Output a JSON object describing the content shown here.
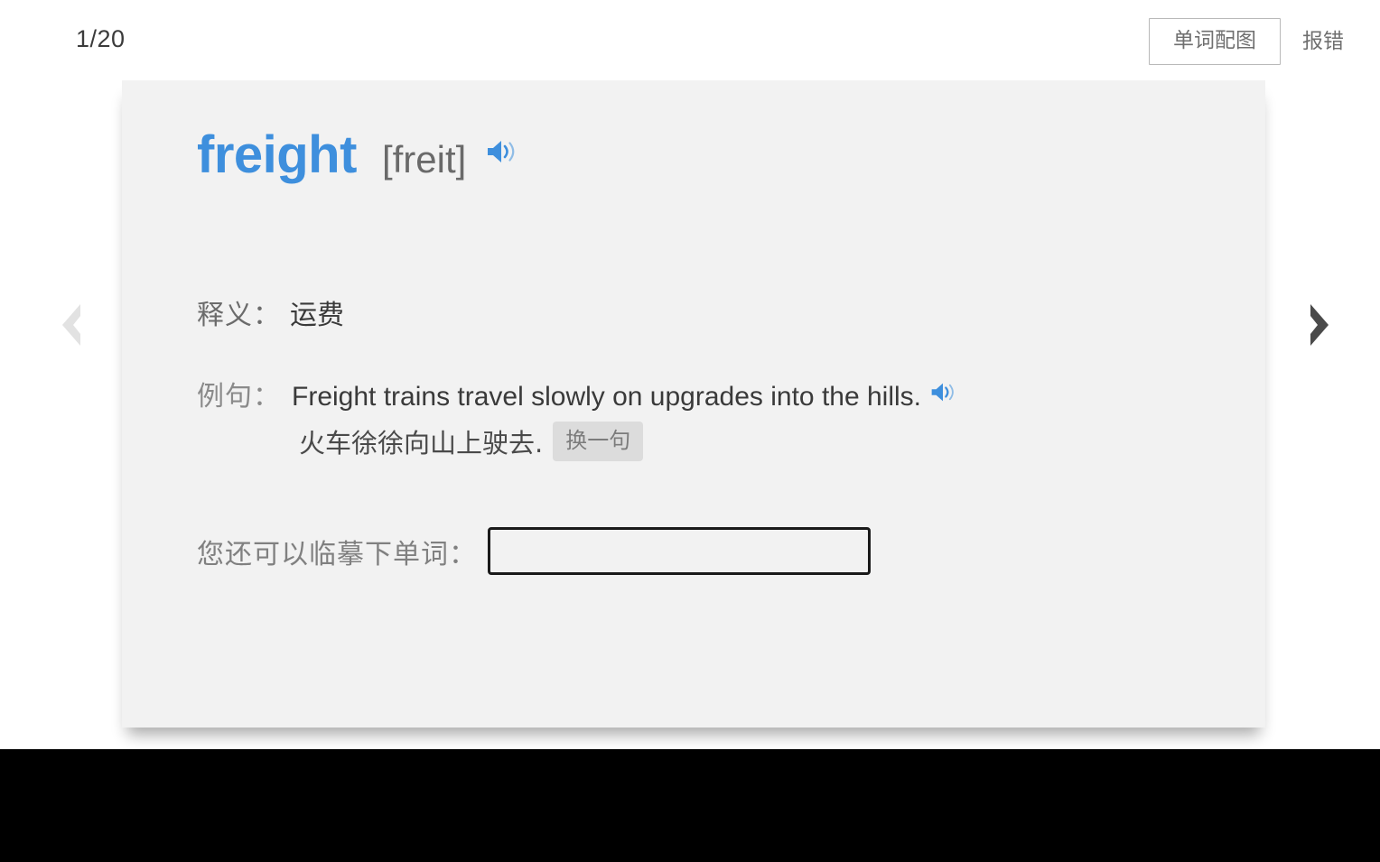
{
  "header": {
    "progress": "1/20",
    "illustration_button": "单词配图",
    "report_link": "报错"
  },
  "card": {
    "word": "freight",
    "phonetic": "[freit]",
    "word_audio_icon": "speaker-icon",
    "definition": {
      "label": "释义：",
      "value": "运费"
    },
    "example": {
      "label": "例句：",
      "english": "Freight trains travel slowly on upgrades into the hills.",
      "audio_icon": "speaker-icon",
      "chinese": "火车徐徐向山上驶去.",
      "change_button": "换一句"
    },
    "practice": {
      "label": "您还可以临摹下单词：",
      "value": "",
      "placeholder": ""
    }
  },
  "navigation": {
    "prev_icon": "chevron-left-icon",
    "next_icon": "chevron-right-icon",
    "prev_enabled": false,
    "next_enabled": true
  },
  "colors": {
    "word_blue": "#3e8fdd",
    "card_bg": "#f2f2f2",
    "page_bg": "#ffffff",
    "band_black": "#000000",
    "arrow_active": "#4a4a4a",
    "arrow_disabled": "#e2e2e2"
  }
}
